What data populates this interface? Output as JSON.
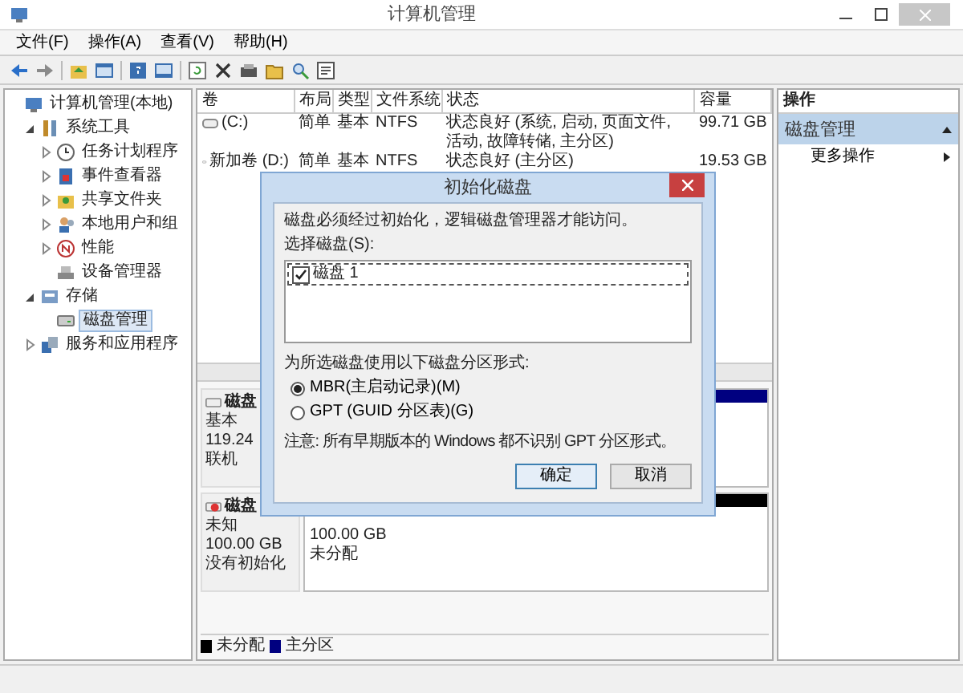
{
  "window": {
    "title": "计算机管理"
  },
  "menu": [
    "文件(F)",
    "操作(A)",
    "查看(V)",
    "帮助(H)"
  ],
  "tree": [
    {
      "label": "计算机管理(本地)",
      "kind": "computer",
      "selected": false,
      "children": [
        {
          "label": "系统工具",
          "kind": "tools",
          "selected": false,
          "expanded": true,
          "children": [
            {
              "label": "任务计划程序",
              "kind": "clock",
              "selected": false,
              "expanded": false
            },
            {
              "label": "事件查看器",
              "kind": "event",
              "selected": false,
              "expanded": false
            },
            {
              "label": "共享文件夹",
              "kind": "share",
              "selected": false,
              "expanded": false
            },
            {
              "label": "本地用户和组",
              "kind": "users",
              "selected": false,
              "expanded": false
            },
            {
              "label": "性能",
              "kind": "perf",
              "selected": false,
              "expanded": false
            },
            {
              "label": "设备管理器",
              "kind": "device",
              "selected": false
            }
          ]
        },
        {
          "label": "存储",
          "kind": "storage",
          "selected": false,
          "expanded": true,
          "children": [
            {
              "label": "磁盘管理",
              "kind": "disk",
              "selected": true
            }
          ]
        },
        {
          "label": "服务和应用程序",
          "kind": "services",
          "selected": false,
          "expanded": false
        }
      ]
    }
  ],
  "volumes": {
    "columns": [
      "卷",
      "布局",
      "类型",
      "文件系统",
      "状态",
      "容量"
    ],
    "rows": [
      {
        "cells": [
          "(C:)",
          "简单",
          "基本",
          "NTFS",
          "状态良好 (系统, 启动, 页面文件, 活动, 故障转储, 主分区)",
          "99.71 GB"
        ]
      },
      {
        "cells": [
          "新加卷 (D:)",
          "简单",
          "基本",
          "NTFS",
          "状态良好 (主分区)",
          "19.53 GB"
        ]
      }
    ]
  },
  "disks": [
    {
      "name": "磁盘",
      "kind": "online",
      "lines": [
        "基本",
        "119.24",
        "联机"
      ],
      "partition": {
        "color": "#000080"
      }
    },
    {
      "name": "磁盘",
      "kind": "uninitialized",
      "lines": [
        "未知",
        "100.00 GB",
        "没有初始化"
      ],
      "partition": {
        "color": "#000000",
        "lines": [
          "100.00 GB",
          "未分配"
        ]
      }
    }
  ],
  "legend": [
    {
      "label": "未分配",
      "color": "#000000"
    },
    {
      "label": "主分区",
      "color": "#000080"
    }
  ],
  "actions": {
    "header": "操作",
    "section": {
      "label": "磁盘管理",
      "expanded": true
    },
    "items": [
      "更多操作"
    ]
  },
  "dialog": {
    "title": "初始化磁盘",
    "message": "磁盘必须经过初始化，逻辑磁盘管理器才能访问。",
    "list_label": "选择磁盘(S):",
    "disks": [
      {
        "label": "磁盘 1",
        "checked": true
      }
    ],
    "style_label": "为所选磁盘使用以下磁盘分区形式:",
    "options": [
      {
        "label": "MBR(主启动记录)(M)",
        "selected": true
      },
      {
        "label": "GPT (GUID 分区表)(G)",
        "selected": false
      }
    ],
    "note": "注意: 所有早期版本的 Windows 都不识别 GPT 分区形式。",
    "buttons": [
      {
        "label": "确定",
        "default": true
      },
      {
        "label": "取消",
        "default": false
      }
    ]
  }
}
